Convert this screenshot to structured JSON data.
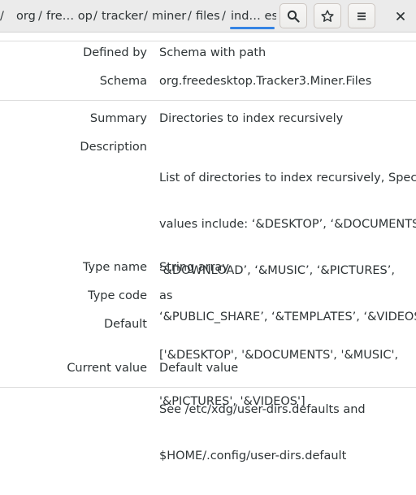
{
  "breadcrumb": {
    "leading_sep": "/",
    "items": [
      "org",
      "fre… op",
      "tracker",
      "miner",
      "files",
      "ind… es"
    ]
  },
  "toolbar": {
    "search_icon": "search-icon",
    "star_icon": "star-icon",
    "menu_icon": "hamburger-menu-icon",
    "close_icon": "close-icon"
  },
  "properties": {
    "defined_by": {
      "label": "Defined by",
      "value": "Schema with path"
    },
    "schema": {
      "label": "Schema",
      "value": "org.freedesktop.Tracker3.Miner.Files"
    },
    "summary": {
      "label": "Summary",
      "value": "Directories to index recursively"
    },
    "description": {
      "label": "Description",
      "lines": [
        "List of directories to index recursively, Special",
        "values include: ‘&DESKTOP’, ‘&DOCUMENTS’,",
        "‘&DOWNLOAD’, ‘&MUSIC’, ‘&PICTURES’,",
        "‘&PUBLIC_SHARE’, ‘&TEMPLATES’, ‘&VIDEOS’.",
        "",
        "See /etc/xdg/user-dirs.defaults and",
        "$HOME/.config/user-dirs.default"
      ]
    },
    "type_name": {
      "label": "Type name",
      "value": "String array"
    },
    "type_code": {
      "label": "Type code",
      "value": "as"
    },
    "default": {
      "label": "Default",
      "lines": [
        "['&DESKTOP', '&DOCUMENTS', '&MUSIC',",
        "'&PICTURES', '&VIDEOS']"
      ]
    },
    "current_value": {
      "label": "Current value",
      "value": "Default value"
    }
  },
  "colors": {
    "accent": "#3584e4",
    "headerbar": "#ebebeb",
    "text": "#2e3436"
  }
}
